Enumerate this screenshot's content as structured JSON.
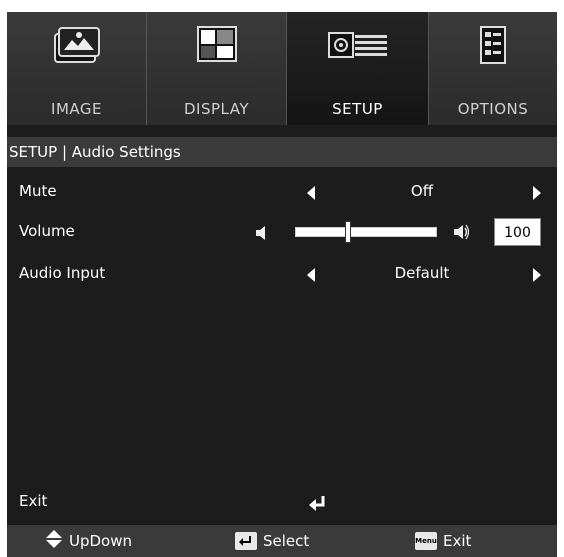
{
  "tabs": [
    {
      "label": "IMAGE",
      "icon": "image-icon",
      "active": false
    },
    {
      "label": "DISPLAY",
      "icon": "display-icon",
      "active": false
    },
    {
      "label": "SETUP",
      "icon": "projector-icon",
      "active": true
    },
    {
      "label": "OPTIONS",
      "icon": "options-icon",
      "active": false
    }
  ],
  "header": {
    "title": "SETUP | Audio Settings"
  },
  "rows": {
    "mute": {
      "label": "Mute",
      "value": "Off"
    },
    "volume": {
      "label": "Volume",
      "value": "100",
      "level": 0.35
    },
    "audio_input": {
      "label": "Audio Input",
      "value": "Default"
    }
  },
  "exit": {
    "label": "Exit"
  },
  "footer": {
    "updown": "UpDown",
    "select": "Select",
    "menu_key": "Menu",
    "exit": "Exit"
  },
  "colors": {
    "background": "#1c1c1c",
    "header": "#3a3a3a",
    "text": "#ffffff"
  }
}
